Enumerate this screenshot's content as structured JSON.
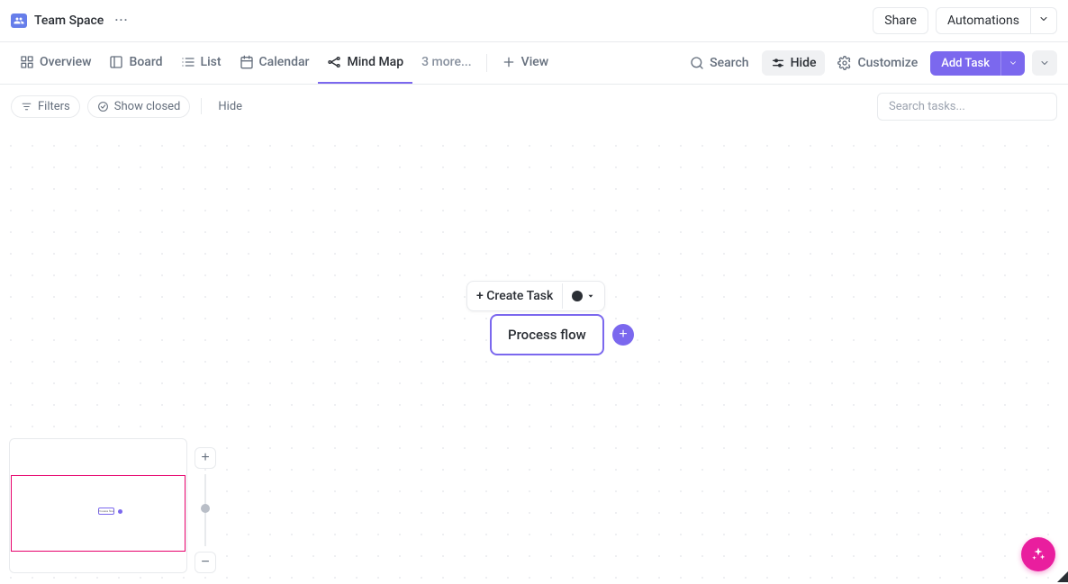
{
  "header": {
    "team_name": "Team Space",
    "share_label": "Share",
    "automations_label": "Automations"
  },
  "tabs": {
    "overview": "Overview",
    "board": "Board",
    "list": "List",
    "calendar": "Calendar",
    "mindmap": "Mind Map",
    "more": "3 more...",
    "view": "View"
  },
  "tools": {
    "search": "Search",
    "hide": "Hide",
    "customize": "Customize",
    "add_task": "Add Task"
  },
  "filters": {
    "filters": "Filters",
    "show_closed": "Show closed",
    "hide": "Hide"
  },
  "search_placeholder": "Search tasks...",
  "canvas": {
    "create_task": "+ Create Task",
    "node_label": "Process flow"
  }
}
